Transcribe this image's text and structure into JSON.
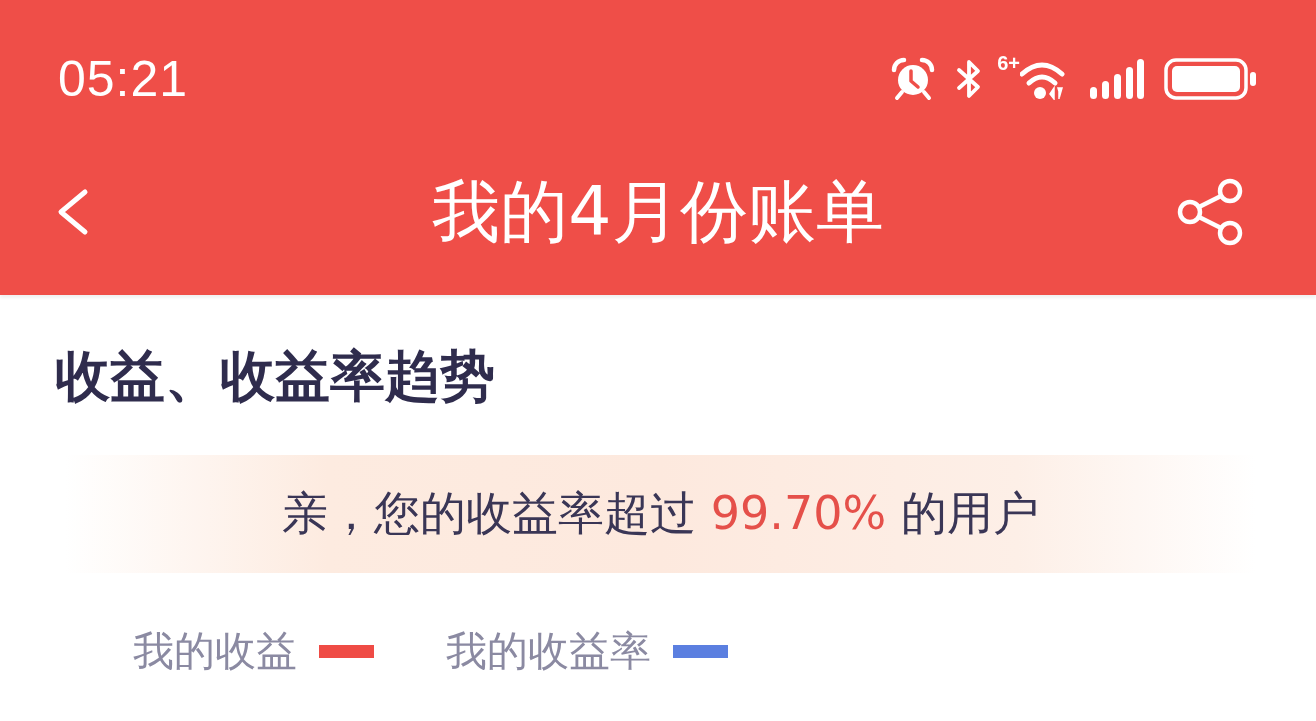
{
  "status_bar": {
    "time": "05:21",
    "network_label": "6+"
  },
  "nav": {
    "title": "我的4月份账单"
  },
  "section": {
    "title": "收益、收益率趋势"
  },
  "rank_banner": {
    "text_before": "亲，您的收益率超过",
    "highlight": "99.70%",
    "text_after": "的用户"
  },
  "legend": [
    {
      "label": "我的收益",
      "color": "#ef4b45"
    },
    {
      "label": "我的收益率",
      "color": "#5b7fe0"
    }
  ]
}
